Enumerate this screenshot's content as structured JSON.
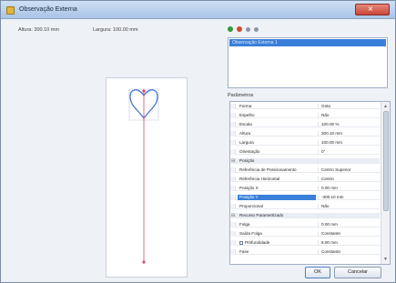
{
  "window": {
    "title": "Observação Externa",
    "close_symbol": "×"
  },
  "info": {
    "altura": "Altura: 300.10 mm",
    "largura": "Largura: 100.00 mm"
  },
  "toolbar": {
    "icons": [
      "add-icon",
      "remove-icon",
      "move-up-icon",
      "move-down-icon"
    ],
    "colors": {
      "add": "#2e9a3a",
      "remove": "#d24a2a",
      "arrow": "#8a96a8"
    }
  },
  "list": {
    "items": [
      "Observação Externa 1"
    ]
  },
  "properties": {
    "label": "Parâmetros",
    "rows": [
      {
        "name": "Forma",
        "value": "Gota"
      },
      {
        "name": "Espelho",
        "value": "Não"
      },
      {
        "name": "Escala",
        "value": "100.00 %"
      },
      {
        "name": "Altura",
        "value": "300.10 mm"
      },
      {
        "name": "Largura",
        "value": "100.00 mm"
      },
      {
        "name": "Orientação",
        "value": "0°"
      },
      {
        "name": "Posição",
        "value": "",
        "category": true
      },
      {
        "name": "Referência de Posicionamento",
        "value": "Centro Superior"
      },
      {
        "name": "Referência Horizontal",
        "value": "Centro"
      },
      {
        "name": "Posição X",
        "value": "0.00 mm"
      },
      {
        "name": "Posição Y",
        "value": "-300.10 mm",
        "selected": true
      },
      {
        "name": "Proporcional",
        "value": "Não"
      },
      {
        "name": "Recurso Parametrizado",
        "value": "",
        "category": true
      },
      {
        "name": "Folga",
        "value": "0.00 mm"
      },
      {
        "name": "Saída Folga",
        "value": "Constante"
      },
      {
        "name": "Profundidade",
        "value": "8.00 mm",
        "checkbox": true
      },
      {
        "name": "Fase",
        "value": "Constante"
      }
    ]
  },
  "buttons": {
    "ok": "OK",
    "cancel": "Cancelar"
  },
  "preview": {
    "guide_color": "#e8455a",
    "shape_color": "#3a6fd0",
    "box_color": "#8aa0c0"
  }
}
